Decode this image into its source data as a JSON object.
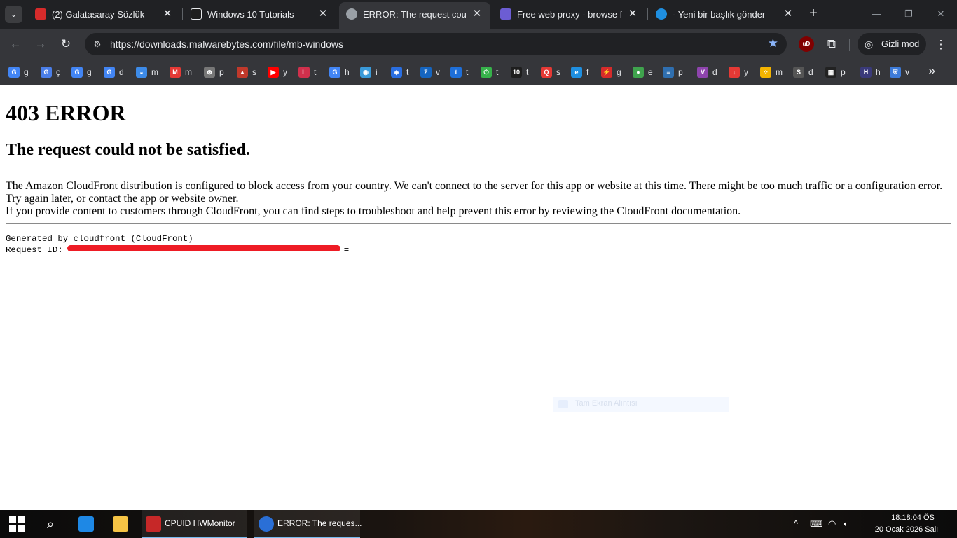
{
  "tabs": [
    {
      "title": "(2) Galatasaray Sözlük",
      "active": false,
      "color": "#d62b2b"
    },
    {
      "title": "Windows 10 Tutorials",
      "active": false,
      "color": "#1e1e1e"
    },
    {
      "title": "ERROR: The request could not",
      "active": true,
      "color": "#9aa0a6"
    },
    {
      "title": "Free web proxy - browse fas",
      "active": false,
      "color": "#6c5dd3"
    },
    {
      "title": "- Yeni bir başlık gönder",
      "active": false,
      "color": "#1f8fe0"
    }
  ],
  "toolbar": {
    "url": "https://downloads.malwarebytes.com/file/mb-windows",
    "incognito_label": "Gizli mod",
    "ublock_label": "uD"
  },
  "bookmarks": [
    {
      "label": "g",
      "color": "#4285f4",
      "icon": "G"
    },
    {
      "label": "ç",
      "color": "#4a7ee8",
      "icon": "G"
    },
    {
      "label": "g",
      "color": "#4285f4",
      "icon": "G"
    },
    {
      "label": "d",
      "color": "#4285f4",
      "icon": "G"
    },
    {
      "label": "m",
      "color": "#3d8be8",
      "icon": "◒"
    },
    {
      "label": "m",
      "color": "#e53935",
      "icon": "M"
    },
    {
      "label": "p",
      "color": "#777777",
      "icon": "⊛"
    },
    {
      "label": "s",
      "color": "#c0392b",
      "icon": "▲"
    },
    {
      "label": "y",
      "color": "#ff0000",
      "icon": "▶"
    },
    {
      "label": "t",
      "color": "#d0304c",
      "icon": "L"
    },
    {
      "label": "h",
      "color": "#4285f4",
      "icon": "G"
    },
    {
      "label": "i",
      "color": "#3a9ad9",
      "icon": "◉"
    },
    {
      "label": "t",
      "color": "#2a6ee0",
      "icon": "◈"
    },
    {
      "label": "v",
      "color": "#1565c0",
      "icon": "Σ"
    },
    {
      "label": "t",
      "color": "#1e6fd9",
      "icon": "t"
    },
    {
      "label": "t",
      "color": "#36b24a",
      "icon": "⏻"
    },
    {
      "label": "t",
      "color": "#1e1e1e",
      "icon": "10"
    },
    {
      "label": "s",
      "color": "#e53935",
      "icon": "Q"
    },
    {
      "label": "f",
      "color": "#1f8fe0",
      "icon": "e"
    },
    {
      "label": "g",
      "color": "#d62b2b",
      "icon": "⚡"
    },
    {
      "label": "e",
      "color": "#3fa34d",
      "icon": "●"
    },
    {
      "label": "p",
      "color": "#2f6fb0",
      "icon": "≡"
    },
    {
      "label": "d",
      "color": "#8e44ad",
      "icon": "V"
    },
    {
      "label": "y",
      "color": "#e53935",
      "icon": "↓"
    },
    {
      "label": "m",
      "color": "#f4b400",
      "icon": "⁘"
    },
    {
      "label": "d",
      "color": "#555555",
      "icon": "S"
    },
    {
      "label": "p",
      "color": "#222222",
      "icon": "▦"
    },
    {
      "label": "h",
      "color": "#3a3a7a",
      "icon": "H"
    },
    {
      "label": "v",
      "color": "#3d7bd9",
      "icon": "⛨"
    }
  ],
  "page": {
    "h1": "403 ERROR",
    "h2": "The request could not be satisfied.",
    "p1": "The Amazon CloudFront distribution is configured to block access from your country. We can't connect to the server for this app or website at this time. There might be too much traffic or a configuration error. Try again later, or contact the app or website owner.",
    "p2": "If you provide content to customers through CloudFront, you can find steps to troubleshoot and help prevent this error by reviewing the CloudFront documentation.",
    "generated_by": "Generated by cloudfront (CloudFront)",
    "request_id_label": "Request ID:",
    "request_id_tail": "=",
    "snip_label": "Tam Ekran Alıntısı"
  },
  "taskbar": {
    "apps": [
      {
        "label": "CPUID HWMonitor",
        "color": "#c62828"
      },
      {
        "label": "ERROR: The reques...",
        "color": "#2a6fd6"
      }
    ],
    "time": "18:18:04 ÖS",
    "date": "20 Ocak 2026 Salı"
  }
}
